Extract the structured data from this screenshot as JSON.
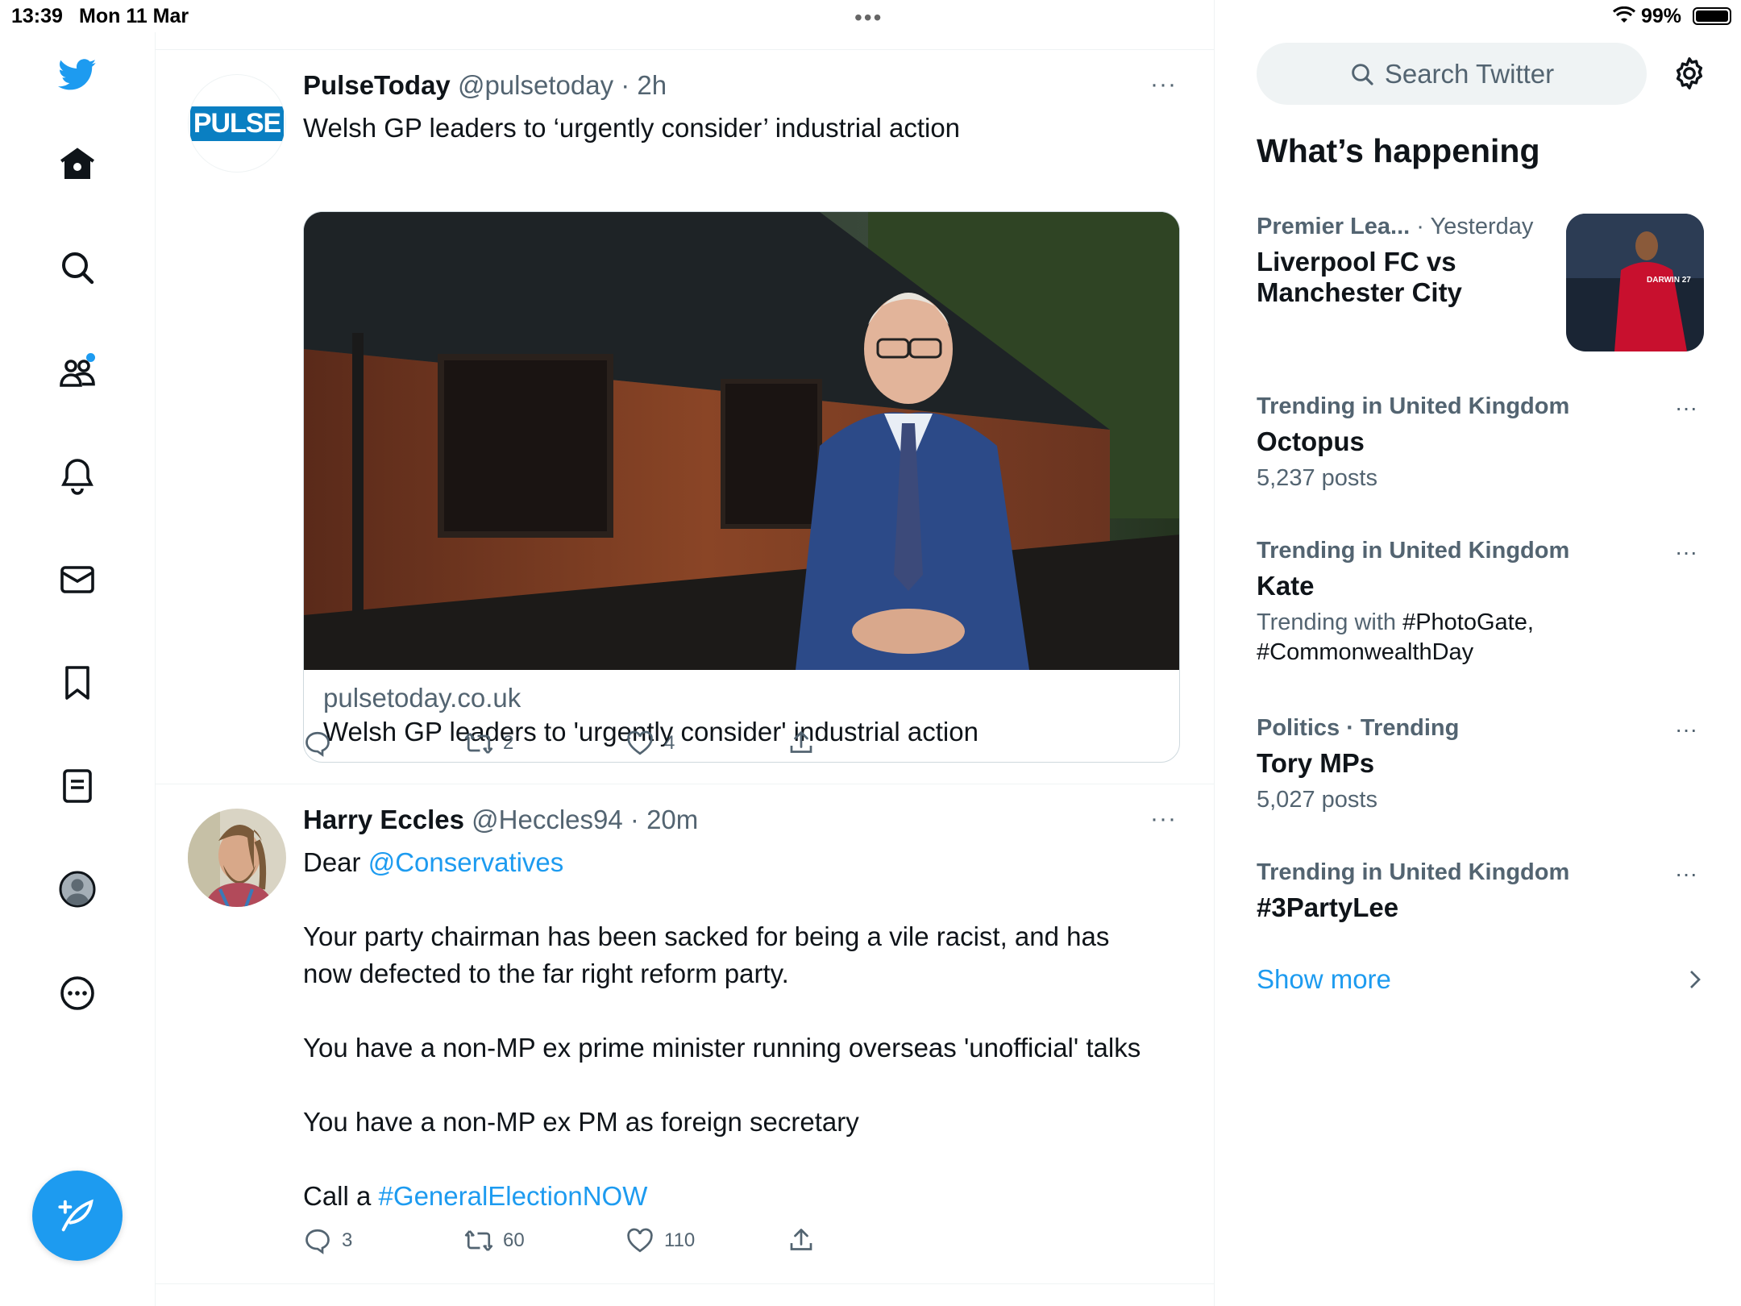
{
  "status_bar": {
    "time": "13:39",
    "date": "Mon 11 Mar",
    "battery_pct": "99%",
    "multitask_dots": "•••"
  },
  "nav": {
    "items": [
      "twitter-logo",
      "home",
      "explore",
      "communities",
      "notifications",
      "messages",
      "bookmarks",
      "lists",
      "profile",
      "more"
    ]
  },
  "compose": {
    "icon": "feather-plus-icon"
  },
  "tweets": [
    {
      "name": "PulseToday",
      "handle": "@pulsetoday",
      "separator": " · ",
      "time": "2h",
      "more": "···",
      "text": "Welsh GP leaders to ‘urgently consider’ industrial action",
      "avatar_text": "PULSE",
      "card": {
        "domain": "pulsetoday.co.uk",
        "title": "Welsh GP leaders to 'urgently consider' industrial action"
      },
      "actions": {
        "reply": "",
        "retweet": "2",
        "like": "4"
      }
    },
    {
      "name": "Harry Eccles",
      "handle": "@Heccles94",
      "separator": " · ",
      "time": "20m",
      "more": "···",
      "text_intro": "Dear ",
      "mention": "@Conservatives",
      "para1_line1": "Your party chairman has been sacked for being a vile racist, and has",
      "para1_line2": "now defected to the far right reform party.",
      "para2": "You have a non-MP ex prime minister running overseas 'unofficial' talks",
      "para3": "You have a non-MP ex PM as foreign secretary",
      "para4_text": "Call a ",
      "hashtag": "#GeneralElectionNOW",
      "actions": {
        "reply": "3",
        "retweet": "60",
        "like": "110"
      }
    }
  ],
  "sidebar": {
    "search_placeholder": "Search Twitter",
    "section_title": "What’s happening",
    "trends": [
      {
        "meta": "Premier Lea...",
        "meta_time": " · Yesterday",
        "topic_line1": "Liverpool FC vs",
        "topic_line2": "Manchester City",
        "image_text": "DARWIN 27"
      },
      {
        "meta": "Trending in United Kingdom",
        "topic": "Octopus",
        "sub": "5,237 posts",
        "more": "···"
      },
      {
        "meta": "Trending in United Kingdom",
        "topic": "Kate",
        "sub_prefix": "Trending with ",
        "sub_tag1": "#PhotoGate,",
        "sub_tag2": "#CommonwealthDay",
        "more": "···"
      },
      {
        "meta": "Politics · Trending",
        "topic": "Tory MPs",
        "sub": "5,027 posts",
        "more": "···"
      },
      {
        "meta": "Trending in United Kingdom",
        "topic": "#3PartyLee",
        "more": "···"
      }
    ],
    "show_more": "Show more"
  },
  "colors": {
    "accent": "#1d9bf0",
    "text_primary": "#0f1419",
    "text_secondary": "#536471",
    "border": "#eff3f4"
  }
}
